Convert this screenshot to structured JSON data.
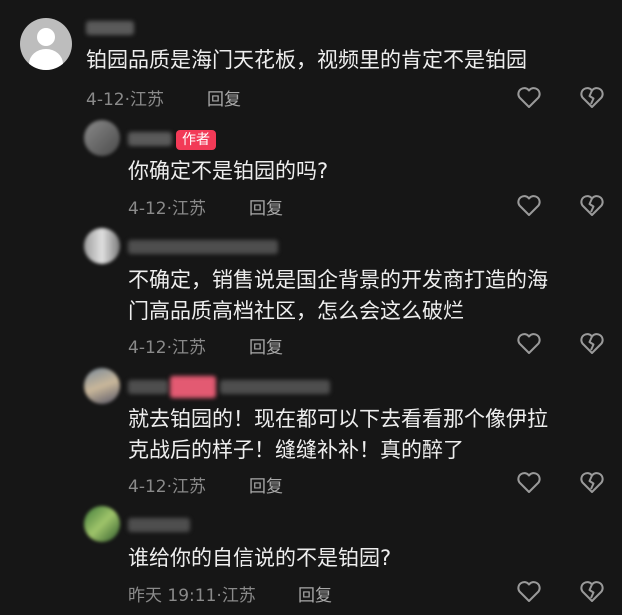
{
  "comments": [
    {
      "text_lines": [
        "铂园品质是海门天花板，视频里的肯定不是铂园"
      ],
      "date": "4-12",
      "location": "江苏",
      "reply_label": "回复"
    },
    {
      "badge": "作者",
      "text_lines": [
        "你确定不是铂园的吗?"
      ],
      "date": "4-12",
      "location": "江苏",
      "reply_label": "回复"
    },
    {
      "text_lines": [
        "不确定，销售说是国企背景的开发商打造的海",
        "门高品质高档社区，怎么会这么破烂"
      ],
      "date": "4-12",
      "location": "江苏",
      "reply_label": "回复"
    },
    {
      "text_lines": [
        "就去铂园的！现在都可以下去看看那个像伊拉",
        "克战后的样子！缝缝补补！真的醉了"
      ],
      "date": "4-12",
      "location": "江苏",
      "reply_label": "回复"
    },
    {
      "text_lines": [
        "谁给你的自信说的不是铂园?"
      ],
      "date": "昨天 19:11",
      "location": "江苏",
      "reply_label": "回复"
    }
  ],
  "meta_separator": "·",
  "icons": {
    "like": "heart-outline-icon",
    "dislike": "broken-heart-icon"
  },
  "colors": {
    "background": "#161616",
    "text": "#eeeeee",
    "meta": "#8a8a8a",
    "author_badge": "#f23a57"
  }
}
